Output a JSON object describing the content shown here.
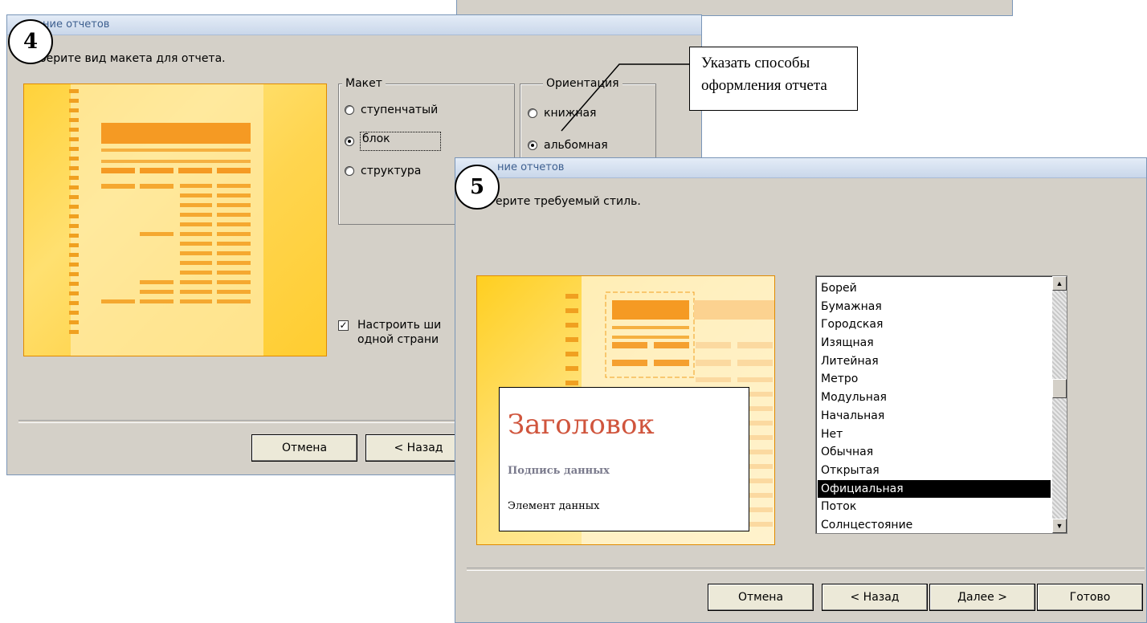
{
  "top_strip": {},
  "dialog4": {
    "badge": "4",
    "title": "ние отчетов",
    "prompt": "берите вид макета для отчета.",
    "layout_group": {
      "legend": "Макет",
      "options": [
        {
          "label": "ступенчатый",
          "checked": false
        },
        {
          "label": "блок",
          "checked": true
        },
        {
          "label": "структура",
          "checked": false
        }
      ]
    },
    "orientation_group": {
      "legend": "Ориентация",
      "options": [
        {
          "label": "книжная",
          "checked": false
        },
        {
          "label": "альбомная",
          "checked": true
        }
      ]
    },
    "fit_checkbox": {
      "line1": "Настроить ши",
      "line2": "одной страни",
      "checked": true
    },
    "buttons": {
      "cancel": "Отмена",
      "back": "< Назад"
    }
  },
  "callout": {
    "text_line1": "Указать способы",
    "text_line2": "оформления отчета"
  },
  "dialog5": {
    "badge": "5",
    "title": "ние отчетов",
    "prompt": "ерите требуемый стиль.",
    "preview": {
      "heading": "Заголовок",
      "caption": "Подпись данных",
      "element": "Элемент данных"
    },
    "styles": [
      "Борей",
      "Бумажная",
      "Городская",
      "Изящная",
      "Литейная",
      "Метро",
      "Модульная",
      "Начальная",
      "Нет",
      "Обычная",
      "Открытая",
      "Официальная",
      "Поток",
      "Солнцестояние"
    ],
    "selected_style": "Официальная",
    "buttons": {
      "cancel": "Отмена",
      "back": "< Назад",
      "next": "Далее >",
      "finish": "Готово"
    }
  },
  "colors": {
    "dialog_bg": "#d4d0c8",
    "accent_orange": "#f5a623",
    "heading_red": "#d0553d"
  }
}
